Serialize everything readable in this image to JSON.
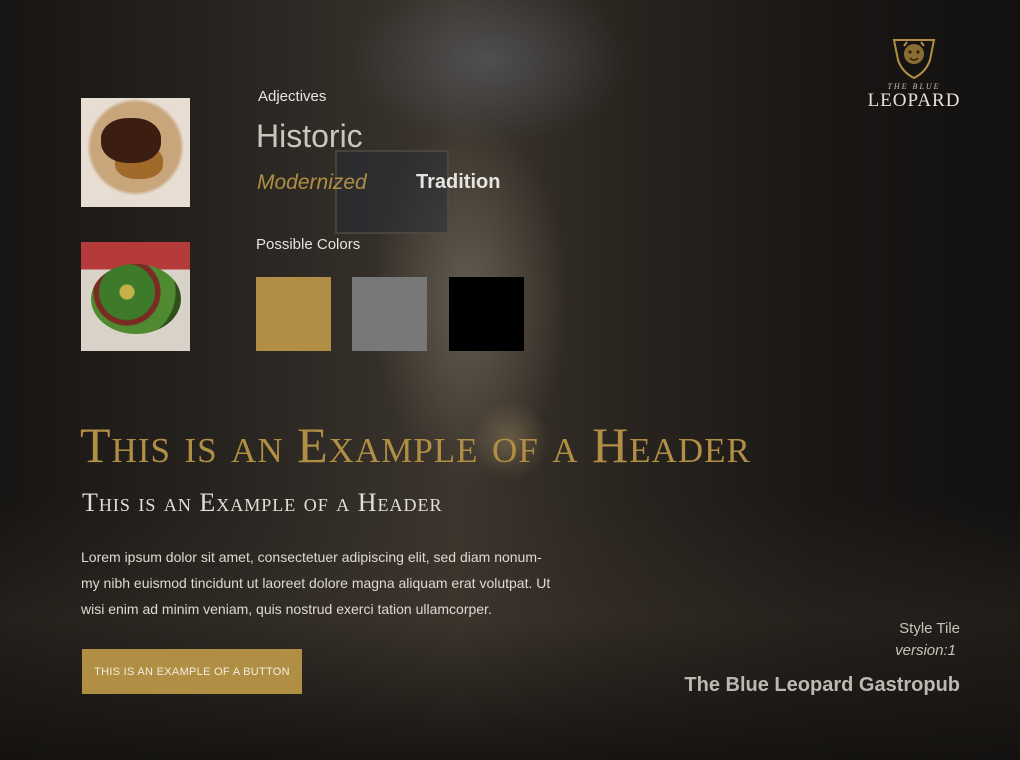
{
  "brand": {
    "logo_small": "THE BLUE",
    "logo_name": "LEOPARD"
  },
  "adjectives": {
    "label": "Adjectives",
    "primary": "Historic",
    "secondary": "Modernized",
    "tertiary": "Tradition"
  },
  "colors": {
    "label": "Possible Colors",
    "swatches": [
      "#b08f45",
      "#787878",
      "#000000"
    ]
  },
  "headers": {
    "large": "This is an Example of a Header",
    "small": "This is an Example of a Header"
  },
  "body_text": "Lorem ipsum dolor sit amet, consectetuer adipiscing elit, sed diam nonum-my nibh euismod tincidunt ut laoreet dolore magna aliquam erat volutpat. Ut wisi enim ad minim veniam, quis nostrud exerci tation ullamcorper.",
  "button": {
    "label": "THIS IS AN EXAMPLE OF A BUTTON"
  },
  "footer": {
    "style_tile": "Style Tile",
    "version": "version:1",
    "project": "The Blue Leopard Gastropub"
  },
  "images": [
    "steak-photo",
    "salad-photo"
  ],
  "theme": {
    "accent": "#b08f45",
    "background": "#141210"
  }
}
